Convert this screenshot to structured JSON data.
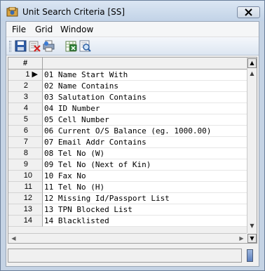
{
  "window": {
    "title": "Unit Search Criteria [SS]"
  },
  "menubar": {
    "items": [
      "File",
      "Grid",
      "Window"
    ]
  },
  "toolbar": {
    "buttons": [
      "save-icon",
      "delete-icon",
      "print-icon",
      "export-excel-icon",
      "preview-icon"
    ]
  },
  "grid": {
    "header": "#",
    "current_row_marker": "▶",
    "rows": [
      {
        "num": "1",
        "text": "01 Name Start With"
      },
      {
        "num": "2",
        "text": "02 Name Contains"
      },
      {
        "num": "3",
        "text": "03 Salutation Contains"
      },
      {
        "num": "4",
        "text": "04 ID Number"
      },
      {
        "num": "5",
        "text": "05 Cell Number"
      },
      {
        "num": "6",
        "text": "06 Current O/S Balance (eg. 1000.00)"
      },
      {
        "num": "7",
        "text": "07 Email Addr Contains"
      },
      {
        "num": "8",
        "text": "08 Tel No (W)"
      },
      {
        "num": "9",
        "text": "09 Tel No (Next of Kin)"
      },
      {
        "num": "10",
        "text": "10 Fax No"
      },
      {
        "num": "11",
        "text": "11 Tel No (H)"
      },
      {
        "num": "12",
        "text": "12 Missing Id/Passport List"
      },
      {
        "num": "13",
        "text": "13 TPN Blocked List"
      },
      {
        "num": "14",
        "text": "14 Blacklisted"
      }
    ]
  },
  "colors": {
    "title_bar": "#c2d3e7",
    "accent": "#5b7fbf"
  }
}
